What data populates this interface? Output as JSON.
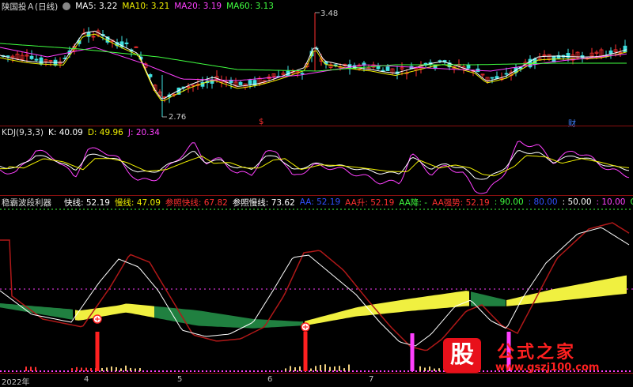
{
  "price_pane": {
    "title": "陕国投Ａ(日线)",
    "ma": [
      {
        "label": "MA5: 3.22",
        "color": "#ffffff"
      },
      {
        "label": "MA10: 3.21",
        "color": "#f0f000"
      },
      {
        "label": "MA20: 3.19",
        "color": "#ff40ff"
      },
      {
        "label": "MA60: 3.13",
        "color": "#40ff40"
      }
    ],
    "high_label": "3.48",
    "low_label": "2.76",
    "marker_left": "$",
    "marker_right": "财"
  },
  "kdj_pane": {
    "title": "KDJ(9,3,3)",
    "k": "K: 40.09",
    "d": "D: 49.96",
    "j": "J: 20.34",
    "colors": {
      "k": "#ffffff",
      "d": "#f0f000",
      "j": "#ff40ff"
    }
  },
  "wave_pane": {
    "title": "稳霸波段利器",
    "items": [
      {
        "label": "快线: 52.19",
        "color": "#ffffff"
      },
      {
        "label": "慢线: 47.09",
        "color": "#f0f000"
      },
      {
        "label": "参照快线: 67.82",
        "color": "#ff3030"
      },
      {
        "label": "参照慢线: 73.62",
        "color": "#ffffff"
      },
      {
        "label": "AA: 52.19",
        "color": "#3050ff"
      },
      {
        "label": "AA升: 52.19",
        "color": "#ff3030"
      },
      {
        "label": "AA降: -",
        "color": "#40ff40"
      },
      {
        "label": "AA强势: 52.19",
        "color": "#ff3030"
      },
      {
        "label": ": 90.00",
        "color": "#40ff40"
      },
      {
        "label": ": 80.00",
        "color": "#3050ff"
      },
      {
        "label": ": 50.00",
        "color": "#ffffff"
      },
      {
        "label": ": 10.00",
        "color": "#ff40ff"
      },
      {
        "label": "GSZX: -",
        "color": "#40ff40"
      }
    ]
  },
  "x_axis": {
    "labels": [
      "2022年",
      "4",
      "5",
      "6",
      "7"
    ]
  },
  "watermark": {
    "logo_text": "股",
    "brand": "公式之家",
    "url": "www.gszj100.com"
  }
}
